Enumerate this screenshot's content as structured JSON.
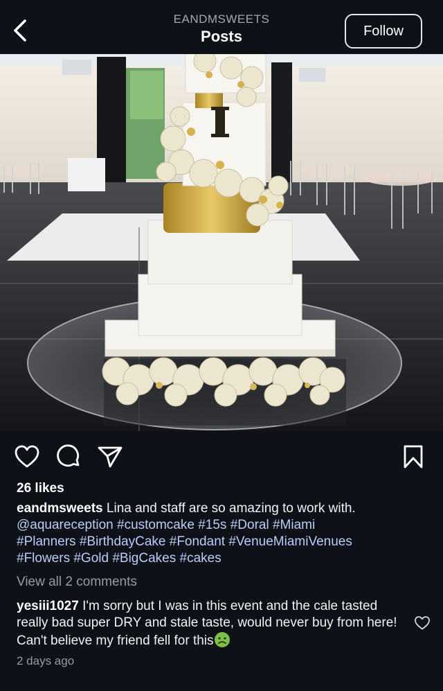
{
  "header": {
    "username": "EANDMSWEETS",
    "title": "Posts",
    "follow_label": "Follow"
  },
  "post": {
    "image_icon": "wedding-cake-photo",
    "likes": "26 likes",
    "caption": {
      "username": "eandmsweets",
      "text": "Lina and staff are so amazing to work with.",
      "tags": [
        "@aquareception",
        "#customcake",
        "#15s",
        "#Doral",
        "#Miami",
        "#Planners",
        "#BirthdayCake",
        "#Fondant",
        "#VenueMiamiVenues",
        "#Flowers",
        "#Gold",
        "#BigCakes",
        "#cakes"
      ]
    },
    "view_all_comments": "View all 2 comments",
    "comment": {
      "username": "yesiii1027",
      "text": "I'm sorry but I was in this event and the cale tasted really bad super DRY and stale taste, would never buy from here! Can't believe my friend fell for this",
      "emoji_icon": "nauseated-face-icon"
    },
    "timestamp": "2 days ago"
  },
  "icons": {
    "back": "chevron-left-icon",
    "like": "heart-icon",
    "comment": "comment-bubble-icon",
    "share": "paper-plane-icon",
    "save": "bookmark-icon"
  },
  "colors": {
    "background": "#0e1117",
    "tag": "#b9cdf7",
    "muted": "#9a9aa0",
    "gold": "#c9a440"
  }
}
